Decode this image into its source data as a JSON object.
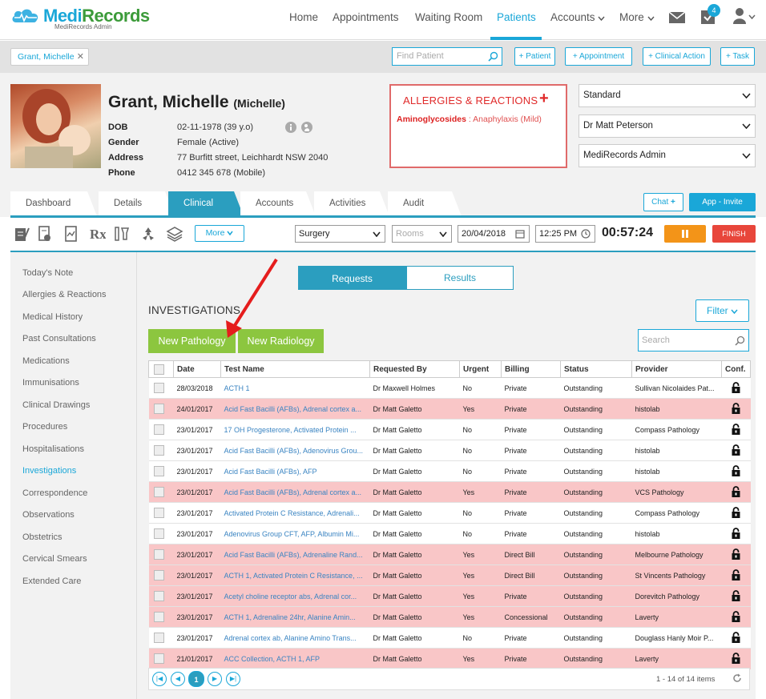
{
  "app": {
    "name_part1": "Medi",
    "name_part2": "Records",
    "subtitle": "MediRecords Admin"
  },
  "nav": {
    "items": [
      {
        "label": "Home"
      },
      {
        "label": "Appointments"
      },
      {
        "label": "Waiting Room"
      },
      {
        "label": "Patients"
      },
      {
        "label": "Accounts"
      },
      {
        "label": "More"
      }
    ],
    "active": "Patients",
    "task_badge": "4"
  },
  "toolbar_top": {
    "patient_chip": "Grant, Michelle",
    "find_patient_placeholder": "Find Patient",
    "buttons": [
      "+ Patient",
      "+ Appointment",
      "+ Clinical Action",
      "+ Task"
    ]
  },
  "patient": {
    "surname_first": "Grant, Michelle",
    "preferred": "(Michelle)",
    "labels": {
      "dob": "DOB",
      "gender": "Gender",
      "address": "Address",
      "phone": "Phone"
    },
    "dob": "02-11-1978 (39 y.o)",
    "gender": "Female (Active)",
    "address": "77 Burfitt street, Leichhardt NSW 2040",
    "phone": "0412 345 678 (Mobile)"
  },
  "allergies": {
    "title": "ALLERGIES & REACTIONS",
    "items": [
      {
        "substance": "Aminoglycosides",
        "reaction": "Anaphylaxis (Mild)"
      }
    ]
  },
  "selectors": [
    "Standard",
    "Dr Matt Peterson",
    "MediRecords Admin"
  ],
  "tabs": [
    "Dashboard",
    "Details",
    "Clinical",
    "Accounts",
    "Activities",
    "Audit"
  ],
  "active_tab": "Clinical",
  "chat_label": "Chat",
  "invite_label": "App - Invite",
  "clinical_toolbar": {
    "more_label": "More",
    "location": "Surgery",
    "rooms_placeholder": "Rooms",
    "date": "20/04/2018",
    "time": "12:25 PM",
    "timer": "00:57:24",
    "finish_label": "FINISH"
  },
  "sidebar": {
    "items": [
      "Today's Note",
      "Allergies & Reactions",
      "Medical History",
      "Past Consultations",
      "Medications",
      "Immunisations",
      "Clinical Drawings",
      "Procedures",
      "Hospitalisations",
      "Investigations",
      "Correspondence",
      "Observations",
      "Obstetrics",
      "Cervical Smears",
      "Extended Care"
    ],
    "active": "Investigations"
  },
  "segments": {
    "requests": "Requests",
    "results": "Results"
  },
  "investigations": {
    "title": "INVESTIGATIONS",
    "filter_label": "Filter",
    "new_pathology": "New Pathology",
    "new_radiology": "New Radiology",
    "search_placeholder": "Search",
    "columns": [
      "",
      "Date",
      "Test Name",
      "Requested By",
      "Urgent",
      "Billing",
      "Status",
      "Provider",
      "Conf."
    ],
    "rows": [
      [
        "28/03/2018",
        "ACTH 1",
        "Dr Maxwell Holmes",
        "No",
        "Private",
        "Outstanding",
        "Sullivan Nicolaides Pat..."
      ],
      [
        "24/01/2017",
        "Acid Fast Bacilli (AFBs), Adrenal cortex a...",
        "Dr Matt Galetto",
        "Yes",
        "Private",
        "Outstanding",
        "histolab"
      ],
      [
        "23/01/2017",
        "17 OH Progesterone, Activated Protein ...",
        "Dr Matt Galetto",
        "No",
        "Private",
        "Outstanding",
        "Compass Pathology"
      ],
      [
        "23/01/2017",
        "Acid Fast Bacilli (AFBs), Adenovirus Grou...",
        "Dr Matt Galetto",
        "No",
        "Private",
        "Outstanding",
        "histolab"
      ],
      [
        "23/01/2017",
        "Acid Fast Bacilli (AFBs), AFP",
        "Dr Matt Galetto",
        "No",
        "Private",
        "Outstanding",
        "histolab"
      ],
      [
        "23/01/2017",
        "Acid Fast Bacilli (AFBs), Adrenal cortex a...",
        "Dr Matt Galetto",
        "Yes",
        "Private",
        "Outstanding",
        "VCS Pathology"
      ],
      [
        "23/01/2017",
        "Activated Protein C Resistance, Adrenali...",
        "Dr Matt Galetto",
        "No",
        "Private",
        "Outstanding",
        "Compass Pathology"
      ],
      [
        "23/01/2017",
        "Adenovirus Group CFT, AFP, Albumin Mi...",
        "Dr Matt Galetto",
        "No",
        "Private",
        "Outstanding",
        "histolab"
      ],
      [
        "23/01/2017",
        "Acid Fast Bacilli (AFBs), Adrenaline Rand...",
        "Dr Matt Galetto",
        "Yes",
        "Direct Bill",
        "Outstanding",
        "Melbourne Pathology"
      ],
      [
        "23/01/2017",
        "ACTH 1, Activated Protein C Resistance, ...",
        "Dr Matt Galetto",
        "Yes",
        "Direct Bill",
        "Outstanding",
        "St Vincents Pathology"
      ],
      [
        "23/01/2017",
        "Acetyl choline receptor abs, Adrenal cor...",
        "Dr Matt Galetto",
        "Yes",
        "Private",
        "Outstanding",
        "Dorevitch Pathology"
      ],
      [
        "23/01/2017",
        "ACTH 1, Adrenaline 24hr, Alanine Amin...",
        "Dr Matt Galetto",
        "Yes",
        "Concessional",
        "Outstanding",
        "Laverty"
      ],
      [
        "23/01/2017",
        "Adrenal cortex ab, Alanine Amino Trans...",
        "Dr Matt Galetto",
        "No",
        "Private",
        "Outstanding",
        "Douglass Hanly Moir P..."
      ],
      [
        "21/01/2017",
        "ACC Collection, ACTH 1, AFP",
        "Dr Matt Galetto",
        "Yes",
        "Private",
        "Outstanding",
        "Laverty"
      ]
    ],
    "pager": {
      "current": "1",
      "info": "1 - 14 of 14 items"
    }
  },
  "colors": {
    "accent": "#1aa7d8",
    "urgent_row": "#f9c6c7",
    "green_button": "#8cc63f",
    "pause": "#f39418",
    "finish": "#e8463b"
  }
}
